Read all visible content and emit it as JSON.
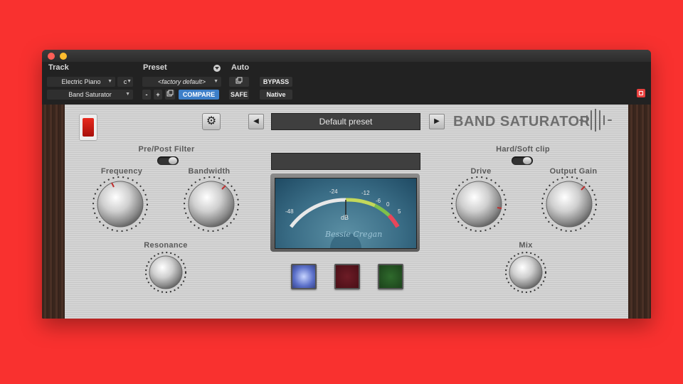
{
  "host": {
    "track_label": "Track",
    "preset_label": "Preset",
    "auto_label": "Auto",
    "track_name": "Electric Piano",
    "track_channel": "c",
    "insert_name": "Band Saturator",
    "preset_value": "<factory default>",
    "minus": "-",
    "plus": "+",
    "compare": "COMPARE",
    "bypass": "BYPASS",
    "safe": "SAFE",
    "native": "Native"
  },
  "plugin": {
    "preset_name": "Default preset",
    "brand": "BAND SATURATOR",
    "labels": {
      "pre_post": "Pre/Post Filter",
      "frequency": "Frequency",
      "bandwidth": "Bandwidth",
      "resonance": "Resonance",
      "hard_soft": "Hard/Soft clip",
      "drive": "Drive",
      "output_gain": "Output Gain",
      "mix": "Mix"
    },
    "meter": {
      "scale": [
        "-48",
        "-24",
        "-12",
        "-6",
        "0",
        "5"
      ],
      "unit": "dB",
      "signature": "Bessie Cregan"
    }
  },
  "colors": {
    "background": "#f9312f",
    "accent_blue": "#3d7fc9",
    "power_red": "#d81f16"
  }
}
